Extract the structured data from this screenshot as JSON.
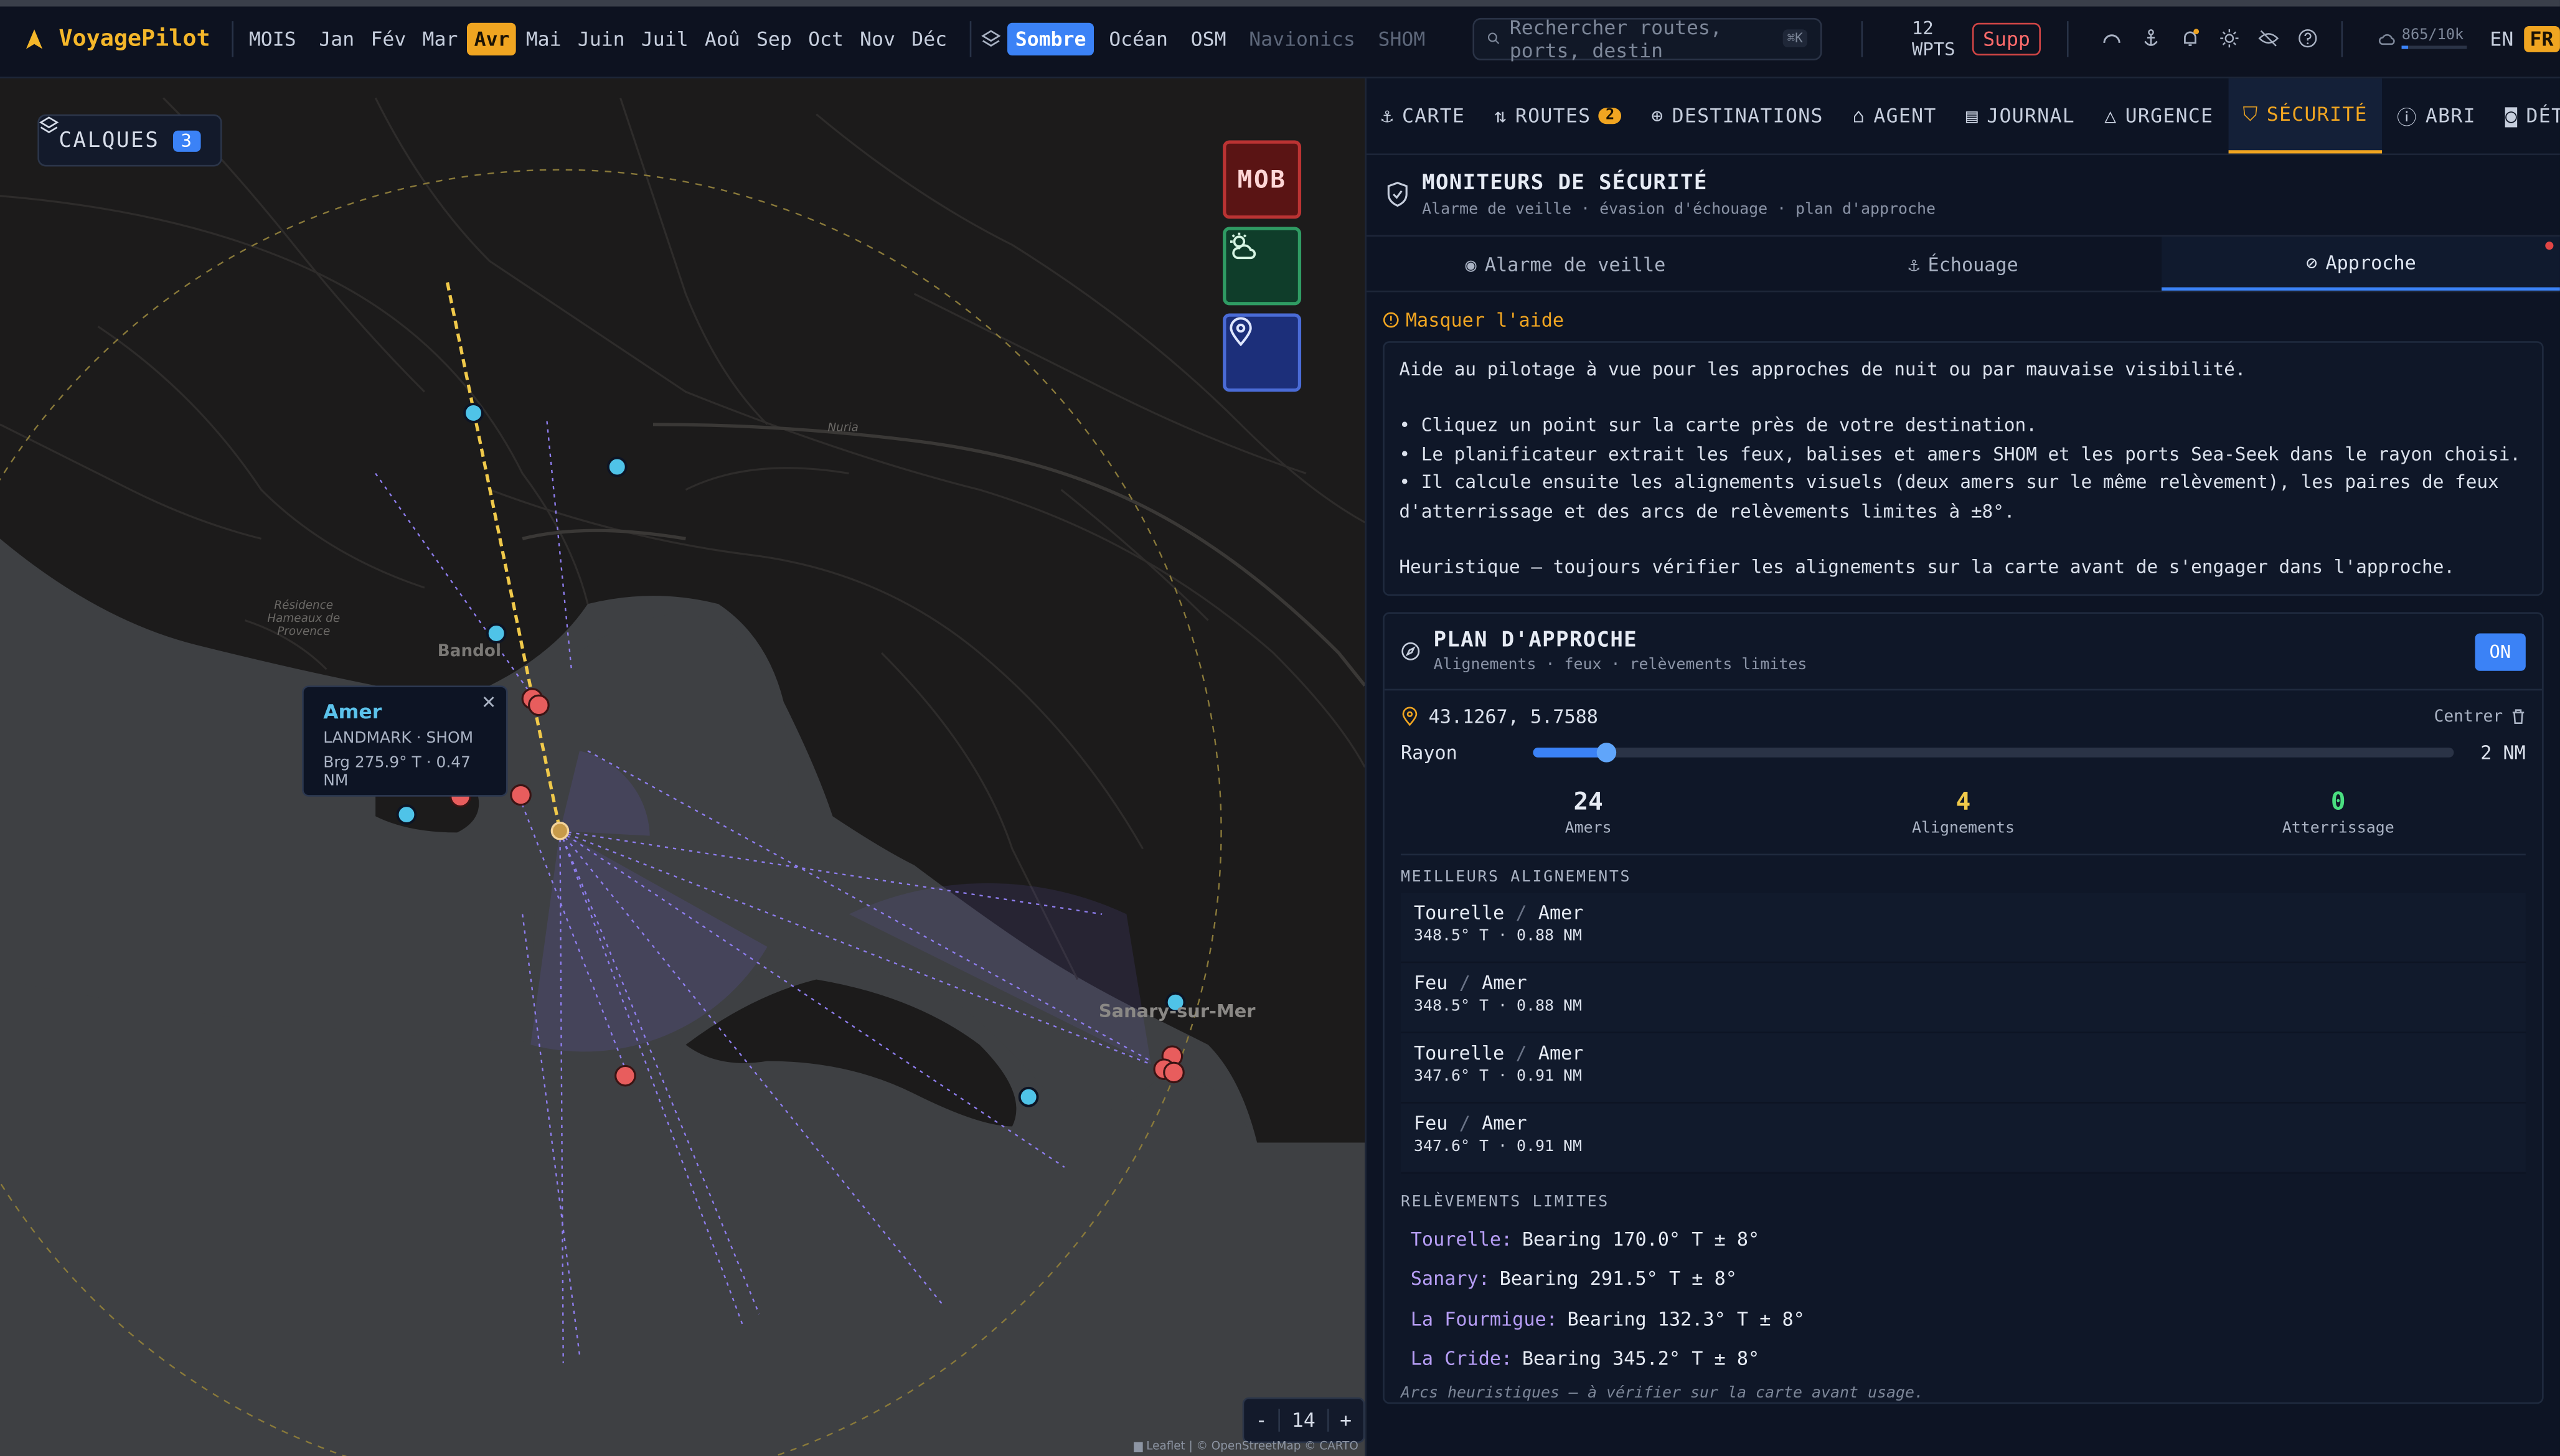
{
  "app": {
    "name": "VoyagePilot"
  },
  "months": {
    "label": "MOIS",
    "items": [
      "Jan",
      "Fév",
      "Mar",
      "Avr",
      "Mai",
      "Juin",
      "Juil",
      "Aoû",
      "Sep",
      "Oct",
      "Nov",
      "Déc"
    ],
    "active": "Avr"
  },
  "basemaps": {
    "items": [
      "Sombre",
      "Océan",
      "OSM",
      "Navionics",
      "SHOM"
    ],
    "active": "Sombre",
    "disabled": [
      "Navionics",
      "SHOM"
    ]
  },
  "search": {
    "placeholder": "Rechercher routes, ports, destin",
    "shortcut": "⌘K"
  },
  "waypoints": {
    "count": "12",
    "unit": "WPTS",
    "delete_label": "Supp"
  },
  "quota": {
    "text": "865/10k",
    "fraction": 0.0865
  },
  "lang": {
    "en": "EN",
    "fr": "FR",
    "active": "FR"
  },
  "map": {
    "calques_label": "CALQUES",
    "calques_count": "3",
    "mob_label": "MOB",
    "zoom": {
      "minus": "-",
      "level": "14",
      "plus": "+"
    },
    "attribution": "▆ Leaflet | © OpenStreetMap © CARTO",
    "place_labels": {
      "bandol": "Bandol",
      "sanary": "Sanary-sur-Mer",
      "nuria": "Nuria",
      "residence": "Résidence Hameaux de Provence"
    },
    "popup": {
      "title": "Amer",
      "type": "LANDMARK · SHOM",
      "bearing": "Brg 275.9° T · 0.47 NM",
      "close": "✕"
    }
  },
  "tabs": [
    {
      "label": "CARTE",
      "icon": "anchor-icon"
    },
    {
      "label": "ROUTES",
      "icon": "route-icon",
      "count": "2"
    },
    {
      "label": "DESTINATIONS",
      "icon": "globe-icon"
    },
    {
      "label": "AGENT",
      "icon": "robot-icon"
    },
    {
      "label": "JOURNAL",
      "icon": "journal-icon"
    },
    {
      "label": "URGENCE",
      "icon": "warning-icon"
    },
    {
      "label": "SÉCURITÉ",
      "icon": "shield-icon",
      "active": true
    },
    {
      "label": "ABRI",
      "icon": "shelter-icon"
    },
    {
      "label": "DÉTECTION",
      "icon": "camera-icon"
    }
  ],
  "security": {
    "title": "MONITEURS DE SÉCURITÉ",
    "subtitle": "Alarme de veille · évasion d'échouage · plan d'approche",
    "subtabs": [
      "Alarme de veille",
      "Échouage",
      "Approche"
    ],
    "active_subtab": "Approche"
  },
  "help": {
    "toggle": "Masquer l'aide",
    "intro": "Aide au pilotage à vue pour les approches de nuit ou par mauvaise visibilité.",
    "b1": "• Cliquez un point sur la carte près de votre destination.",
    "b2": "• Le planificateur extrait les feux, balises et amers SHOM et les ports Sea-Seek dans le rayon choisi.",
    "b3": "• Il calcule ensuite les alignements visuels (deux amers sur le même relèvement), les paires de feux d'atterrissage et des arcs de relèvements limites à ±8°.",
    "note": "Heuristique — toujours vérifier les alignements sur la carte avant de s'engager dans l'approche."
  },
  "plan": {
    "title": "PLAN D'APPROCHE",
    "subtitle": "Alignements · feux · relèvements limites",
    "toggle": "ON",
    "coords": "43.1267, 5.7588",
    "center_label": "Centrer",
    "radius_label": "Rayon",
    "radius_value": "2 NM",
    "radius_fraction": 0.08,
    "stats": [
      {
        "value": "24",
        "label": "Amers",
        "color": "#e6ebf4"
      },
      {
        "value": "4",
        "label": "Alignements",
        "color": "#f0c94a"
      },
      {
        "value": "0",
        "label": "Atterrissage",
        "color": "#4ade80"
      }
    ],
    "best_label": "MEILLEURS ALIGNEMENTS",
    "alignments": [
      {
        "a": "Tourelle",
        "b": "Amer",
        "detail": "348.5° T · 0.88 NM"
      },
      {
        "a": "Feu",
        "b": "Amer",
        "detail": "348.5° T · 0.88 NM"
      },
      {
        "a": "Tourelle",
        "b": "Amer",
        "detail": "347.6° T · 0.91 NM"
      },
      {
        "a": "Feu",
        "b": "Amer",
        "detail": "347.6° T · 0.91 NM"
      }
    ],
    "limits_label": "RELÈVEMENTS LIMITES",
    "limits": [
      {
        "name": "Tourelle:",
        "text": "Bearing 170.0° T ± 8°"
      },
      {
        "name": "Sanary:",
        "text": "Bearing 291.5° T ± 8°"
      },
      {
        "name": "La Fourmigue:",
        "text": "Bearing 132.3° T ± 8°"
      },
      {
        "name": "La Cride:",
        "text": "Bearing 345.2° T ± 8°"
      }
    ],
    "footnote": "Arcs heuristiques — à vérifier sur la carte avant usage."
  },
  "colors": {
    "accent": "#f0a521",
    "primary": "#3b82f6",
    "danger": "#e04545",
    "landmark": "#5cc3ec",
    "light": "#e85d5d"
  }
}
